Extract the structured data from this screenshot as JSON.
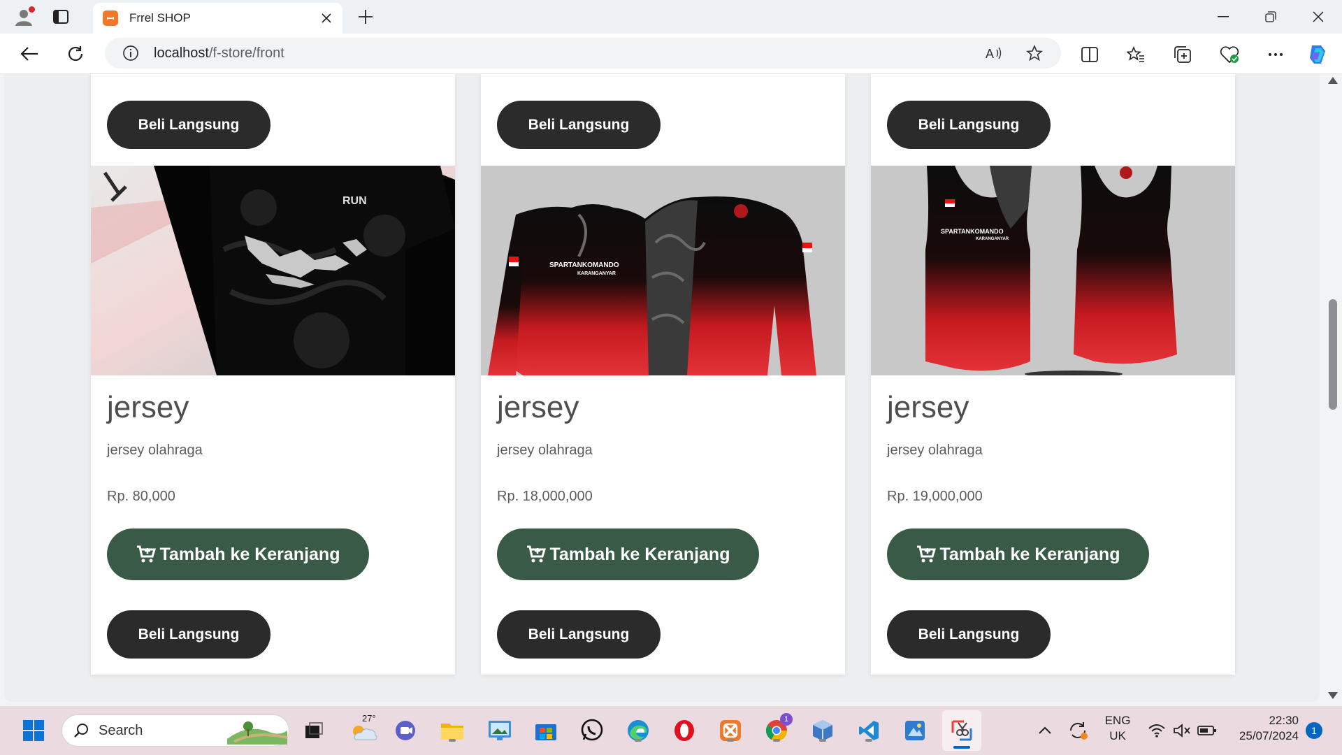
{
  "browser": {
    "tab_title": "Frrel SHOP",
    "url_host": "localhost",
    "url_path": "/f-store/front"
  },
  "products": [
    {
      "title": "jersey",
      "description": "jersey olahraga",
      "price": "Rp. 80,000",
      "image_kind": "black t-shirt with Indonesia map print"
    },
    {
      "title": "jersey",
      "description": "jersey olahraga",
      "price": "Rp. 18,000,000",
      "image_kind": "black-red long sleeve jersey"
    },
    {
      "title": "jersey",
      "description": "jersey olahraga",
      "price": "Rp. 19,000,000",
      "image_kind": "black-red sleeveless jersey"
    }
  ],
  "buttons": {
    "buy_now": "Beli Langsung",
    "add_to_cart": "Tambah ke Keranjang"
  },
  "jersey_print": {
    "team": "SPARTANKOMANDO",
    "sub": "KARANGANYAR",
    "brand": "RUN"
  },
  "taskbar": {
    "search_placeholder": "Search",
    "weather_temp": "27°",
    "lang_line1": "ENG",
    "lang_line2": "UK",
    "time": "22:30",
    "date": "25/07/2024",
    "notification_count": "1",
    "teams_badge": "1"
  },
  "colors": {
    "btn_dark": "#2b2b2b",
    "btn_green": "#3a5a48",
    "page_bg": "#eceef0",
    "taskbar_bg": "#ebdbe0"
  }
}
